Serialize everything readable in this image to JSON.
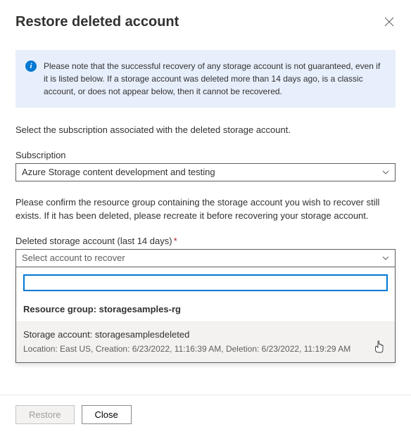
{
  "header": {
    "title": "Restore deleted account"
  },
  "info": {
    "text": "Please note that the successful recovery of any storage account is not guaranteed, even if it is listed below. If a storage account was deleted more than 14 days ago, is a classic account, or does not appear below, then it cannot be recovered."
  },
  "subscription": {
    "instruction": "Select the subscription associated with the deleted storage account.",
    "label": "Subscription",
    "value": "Azure Storage content development and testing"
  },
  "deletedAccount": {
    "instruction": "Please confirm the resource group containing the storage account you wish to recover still exists. If it has been deleted, please recreate it before recovering your storage account.",
    "label": "Deleted storage account (last 14 days)",
    "placeholder": "Select account to recover",
    "searchValue": "",
    "groupLabel": "Resource group: storagesamples-rg",
    "option": {
      "title": "Storage account: storagesamplesdeleted",
      "details": "Location: East US, Creation: 6/23/2022, 11:16:39 AM, Deletion: 6/23/2022, 11:19:29 AM"
    }
  },
  "footer": {
    "restore": "Restore",
    "close": "Close"
  }
}
